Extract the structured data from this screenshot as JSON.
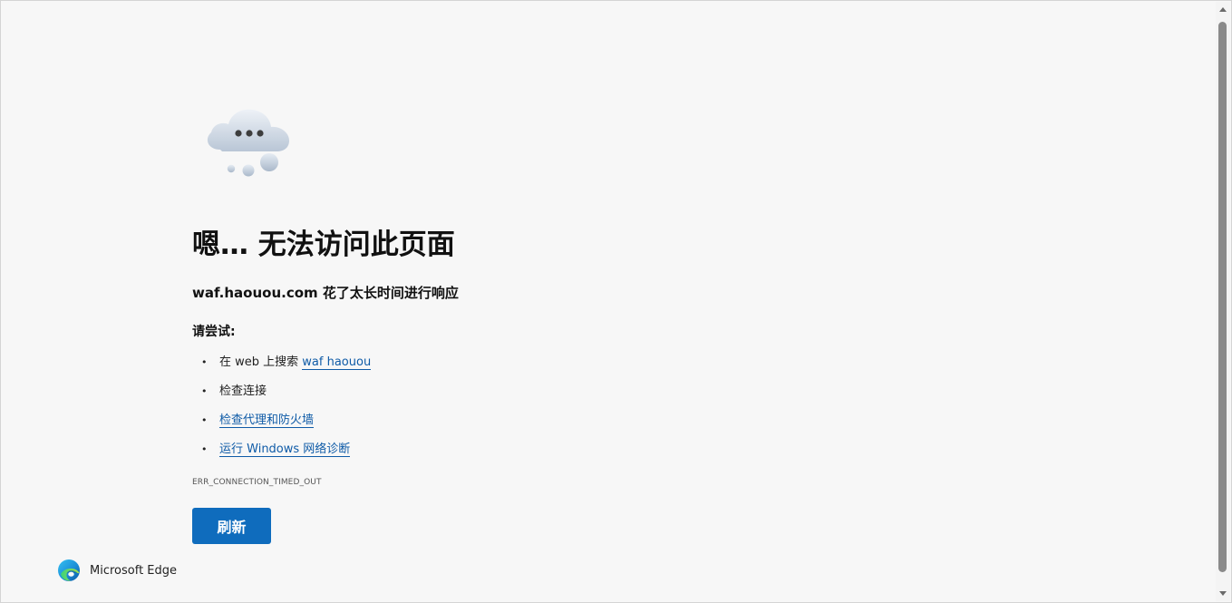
{
  "page": {
    "title": "嗯… 无法访问此页面",
    "host": "waf.haouou.com",
    "message": "花了太长时间进行响应",
    "try_label": "请尝试:",
    "suggestions": [
      {
        "prefix": "在 web 上搜索 ",
        "link": "waf haouou"
      },
      {
        "text": "检查连接"
      },
      {
        "link": "检查代理和防火墙"
      },
      {
        "link": "运行 Windows 网络诊断"
      }
    ],
    "error_code": "ERR_CONNECTION_TIMED_OUT",
    "refresh_label": "刷新"
  },
  "brand": {
    "name": "Microsoft Edge"
  },
  "colors": {
    "background": "#f7f7f7",
    "link": "#0f5ba7",
    "button": "#0f6cbd"
  },
  "icons": {
    "illustration": "thinking-cloud-icon",
    "brand_logo": "edge-logo-icon"
  }
}
